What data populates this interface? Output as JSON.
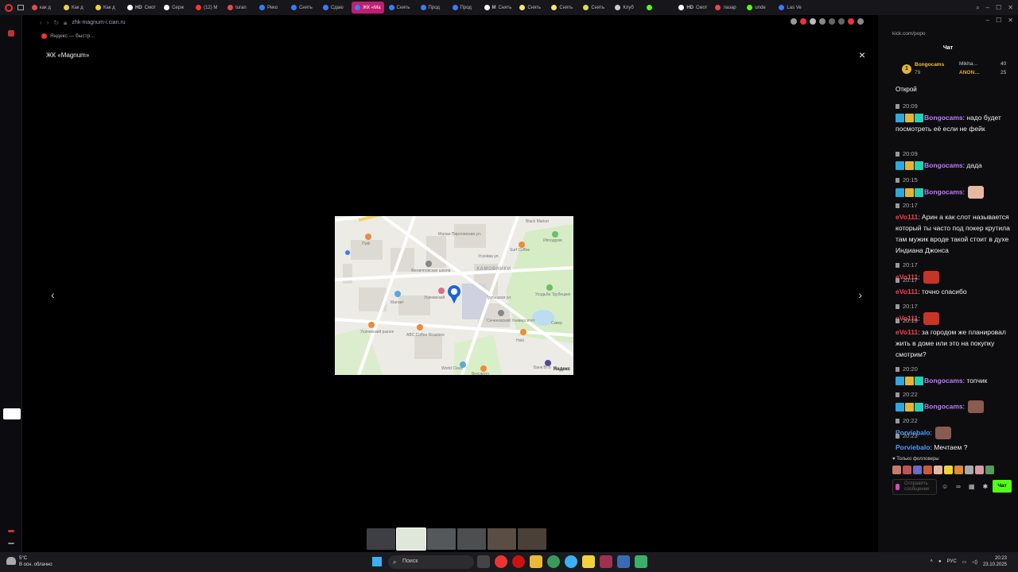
{
  "browser": {
    "tabs": [
      {
        "label": "как д",
        "color": "#e84a4a"
      },
      {
        "label": "Как д",
        "color": "#f0d23a"
      },
      {
        "label": "Как д",
        "color": "#f0d23a"
      },
      {
        "label": "Смот",
        "color": "#ffffff",
        "prefix": "HD"
      },
      {
        "label": "Серж",
        "color": "#ffffff"
      },
      {
        "label": "(12) M",
        "color": "#ff3333"
      },
      {
        "label": "turan",
        "color": "#e84a4a"
      },
      {
        "label": "Реко",
        "color": "#3a7bff"
      },
      {
        "label": "Снять",
        "color": "#3a7bff"
      },
      {
        "label": "Сдаю",
        "color": "#3a7bff"
      },
      {
        "label": "ЖК «Ма",
        "color": "#3a7bff",
        "active": true
      },
      {
        "label": "Снять",
        "color": "#3a7bff"
      },
      {
        "label": "Прод",
        "color": "#3a7bff"
      },
      {
        "label": "Прод",
        "color": "#3a7bff"
      },
      {
        "label": "Снять",
        "color": "#ffffff",
        "prefix": "M"
      },
      {
        "label": "Снять",
        "color": "#f3e27a"
      },
      {
        "label": "Снять",
        "color": "#f3e27a"
      },
      {
        "label": "Снять",
        "color": "#d8d860"
      },
      {
        "label": "Клуб",
        "color": "#cccccc"
      },
      {
        "label": "",
        "color": "#53fc18"
      },
      {
        "label": "Смот",
        "color": "#ffffff",
        "prefix": "HD"
      },
      {
        "label": "лазар",
        "color": "#e84a4a"
      },
      {
        "label": "unde",
        "color": "#53fc18"
      },
      {
        "label": "Las Ve",
        "color": "#3a7bff"
      }
    ],
    "url": "zhk-magnum-i.cian.ru",
    "bookmark": "Яндекс — быстр…"
  },
  "gallery": {
    "title": "ЖК «Magnum»",
    "close_icon": "×",
    "prev_icon": "‹",
    "next_icon": "›",
    "thumbnails": [
      {
        "color": "#3d3f44"
      },
      {
        "color": "#dfe6da",
        "active": true
      },
      {
        "color": "#55585a"
      },
      {
        "color": "#4c4e50"
      },
      {
        "color": "#5a4d43"
      },
      {
        "color": "#4b4037"
      }
    ],
    "map": {
      "district": "ХАМОВНИКИ",
      "pois": [
        "Black Market",
        "Ипподром",
        "Surf Coffee",
        "Пуф",
        "Филипповская школа",
        "Магнит",
        "Усачевский",
        "Сеченовский Университет",
        "Усадьба Трубецких",
        "ABC Coffee Roasters",
        "Усачевский рынок",
        "Hoki",
        "World Class",
        "Вкусвилл",
        "Банк ВТБ",
        "Усачёва ул.",
        "Трубецкая ул.",
        "Малая Пироговская ул.",
        "Сквер"
      ],
      "logo": "Яндекс"
    }
  },
  "chat": {
    "url": "kick.com/popo",
    "title": "Чат",
    "gifters": {
      "rank": "1",
      "first_name": "Bongocams",
      "first_count": "79",
      "second_name": "Mikha…",
      "second_count": "40",
      "third_name": "ANON…",
      "third_count": "25"
    },
    "truncated_text": "Открой",
    "messages": [
      {
        "time": "20:09",
        "user": "Bongocams",
        "text": ": надо будет посмотреть её если не фейк",
        "color": "purple",
        "badges": true
      },
      {
        "time": "20:09",
        "user": "Bongocams",
        "text": ": дада",
        "color": "purple",
        "badges": true
      },
      {
        "time": "20:15",
        "user": "Bongocams",
        "text": ":",
        "color": "purple",
        "badges": true,
        "emote": "face"
      },
      {
        "time": "20:17",
        "user": "eVo111",
        "text": ": Арин а как слот называется который ты часто под покер крутила там мужик вроде такой стоит в духе Индиана Джонса",
        "color": "red"
      },
      {
        "time": "20:17",
        "user": "eVo111",
        "text": ":",
        "color": "red",
        "emote": "red"
      },
      {
        "time": "20:17",
        "user": "eVo111",
        "text": ": точно спасибо",
        "color": "red"
      },
      {
        "time": "20:17",
        "user": "eVo111",
        "text": ":",
        "color": "red",
        "emote": "red"
      },
      {
        "time": "20:19",
        "user": "eVo111",
        "text": ": за городом же планировал жить в доме или это на покупку смотрим?",
        "color": "red"
      },
      {
        "time": "20:20",
        "user": "Bongocams",
        "text": ": топчик",
        "color": "purple",
        "badges": true
      },
      {
        "time": "20:22",
        "user": "Bongocams",
        "text": ":",
        "color": "purple",
        "badges": true,
        "emote": "pic"
      },
      {
        "time": "20:22",
        "user": "Porviebalo",
        "text": ":",
        "color": "blue",
        "emote": "pic"
      },
      {
        "time": "20:23",
        "user": "Porviebalo",
        "text": ": Мечтаем ?",
        "color": "blue"
      }
    ],
    "followers_only": "Только фолловеры",
    "input_placeholder": "Отправить сообщение",
    "send_label": "Чат"
  },
  "taskbar": {
    "temperature": "5°C",
    "weather": "В осн. облачно",
    "search_label": "Поиск",
    "lang": "РУС",
    "time": "20:23",
    "date": "23.10.2025"
  }
}
